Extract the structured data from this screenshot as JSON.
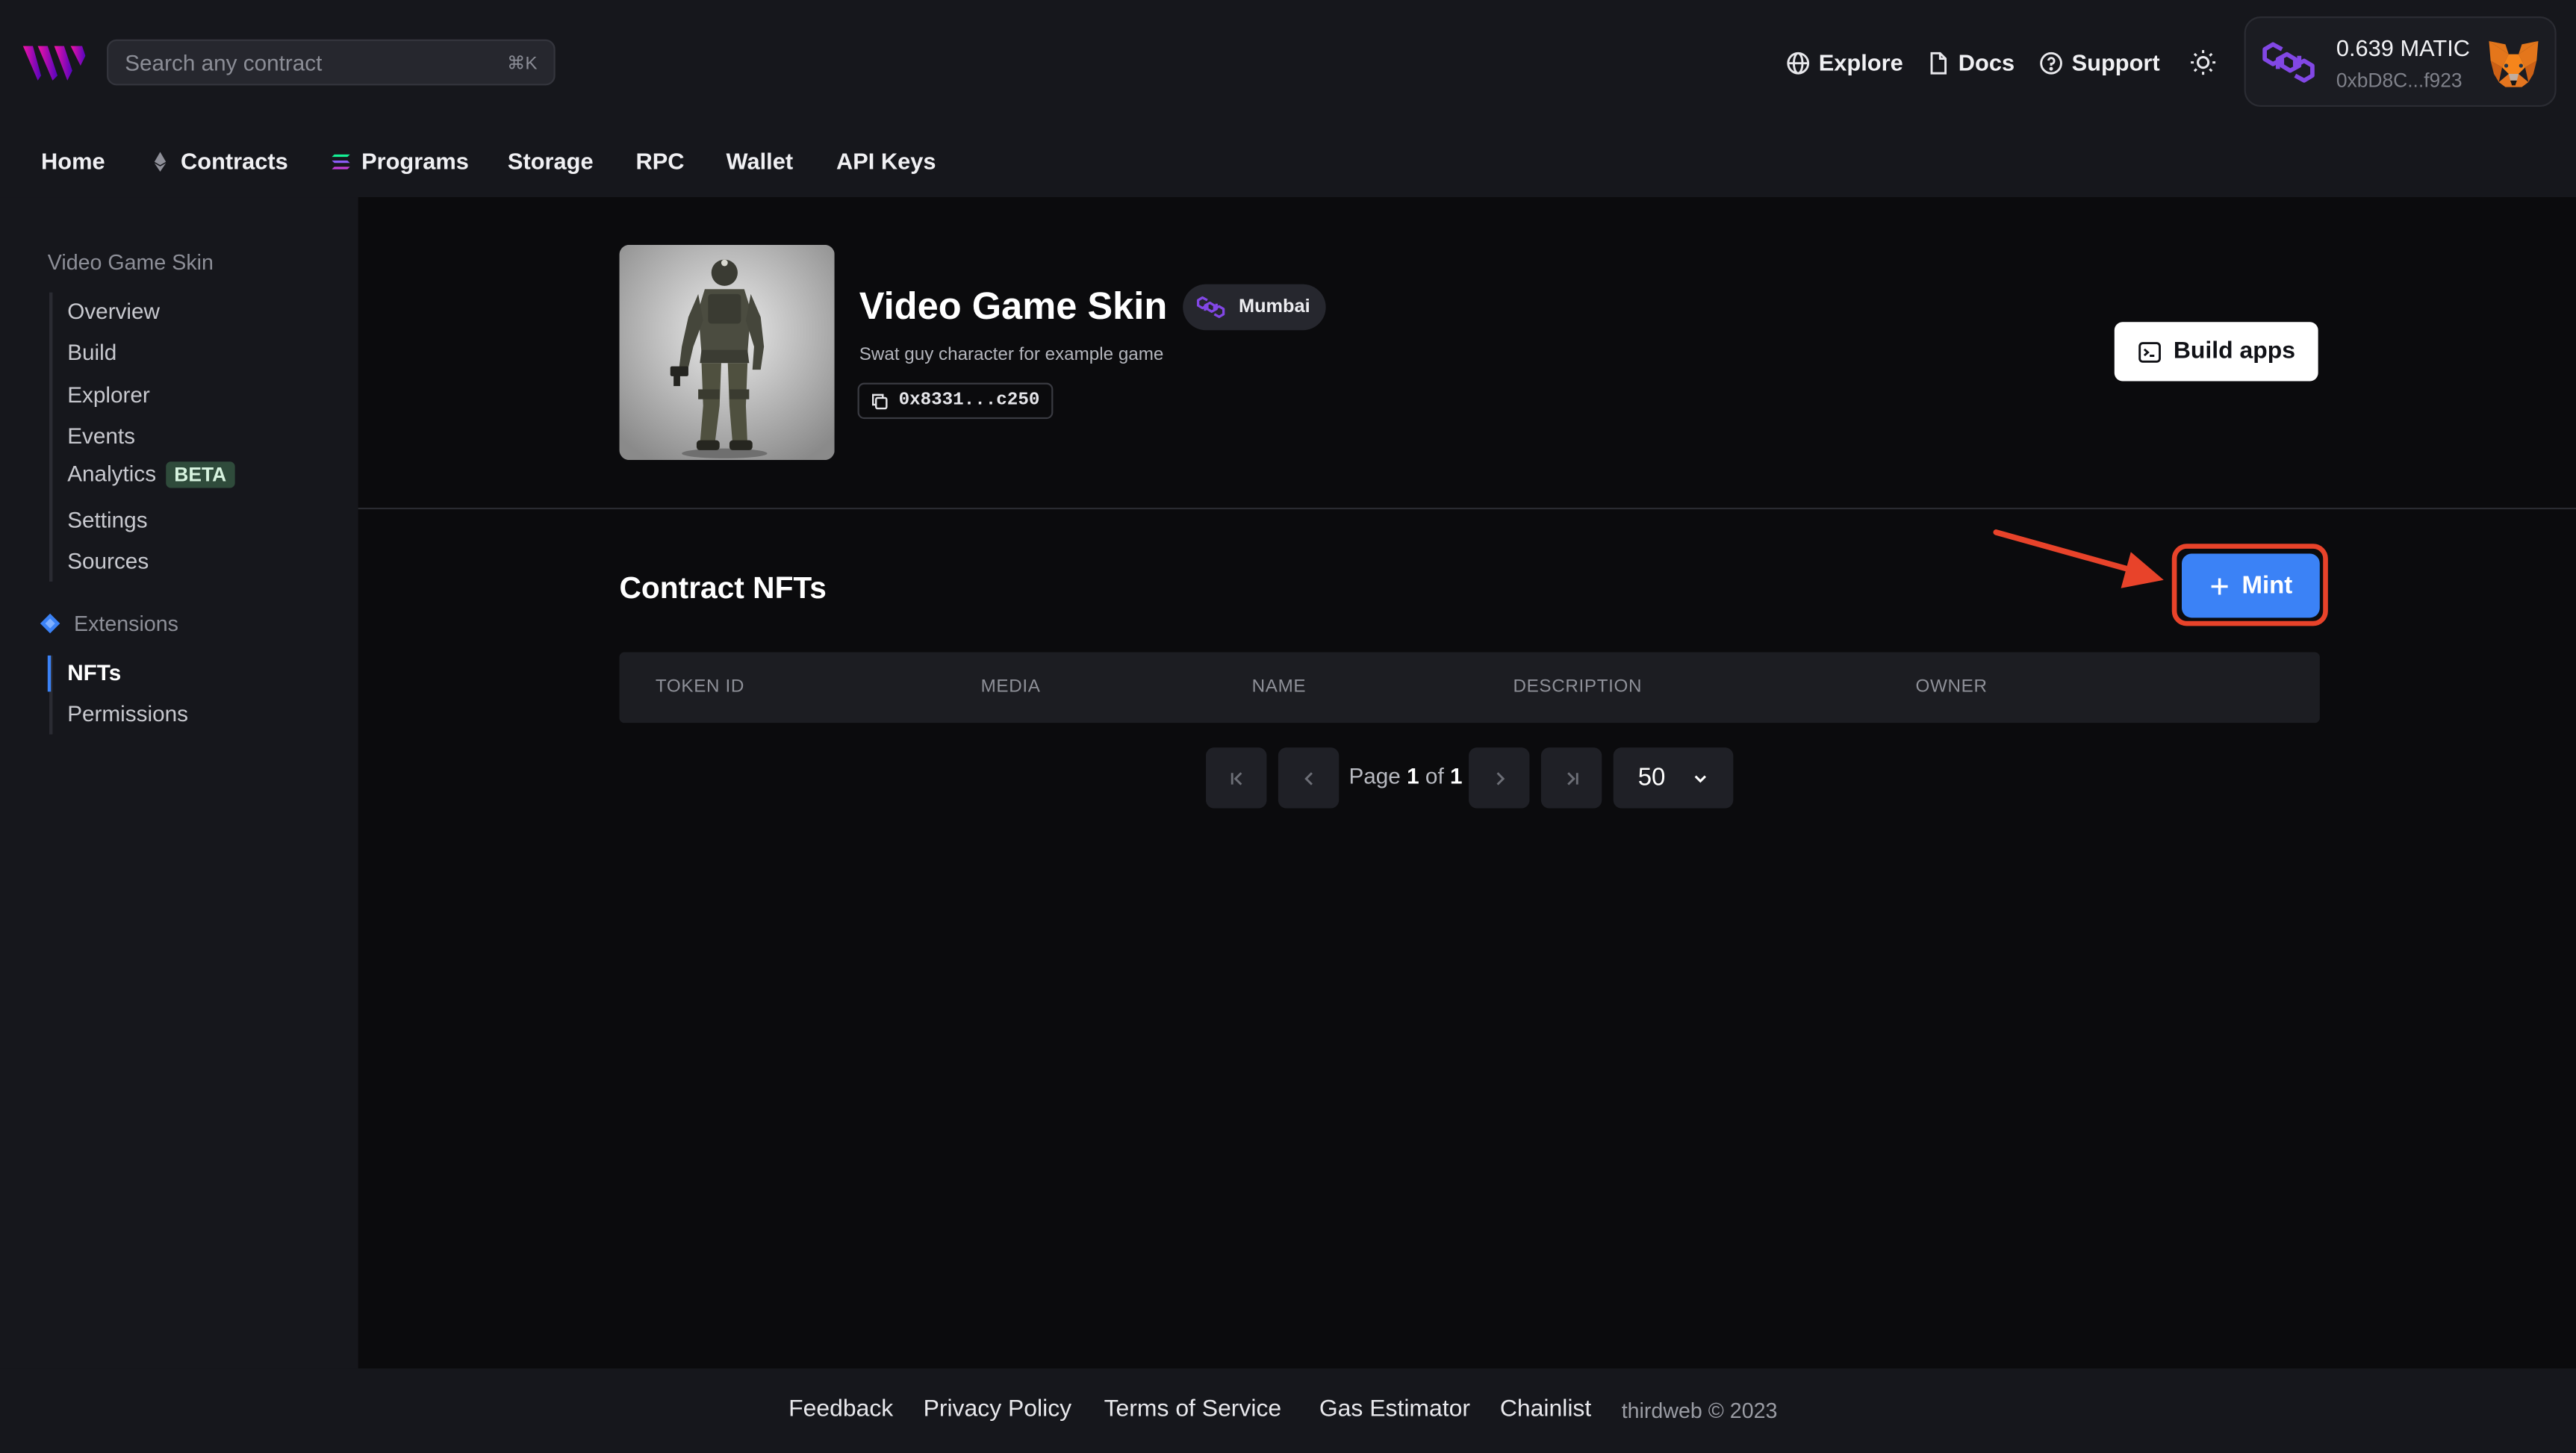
{
  "header": {
    "search_placeholder": "Search any contract",
    "search_shortcut": "⌘K",
    "links": {
      "explore": "Explore",
      "docs": "Docs",
      "support": "Support"
    },
    "wallet": {
      "balance": "0.639 MATIC",
      "address": "0xbD8C...f923"
    }
  },
  "nav": {
    "home": "Home",
    "contracts": "Contracts",
    "programs": "Programs",
    "storage": "Storage",
    "rpc": "RPC",
    "wallet": "Wallet",
    "api_keys": "API Keys"
  },
  "sidebar": {
    "title": "Video Game Skin",
    "items": {
      "overview": "Overview",
      "build": "Build",
      "explorer": "Explorer",
      "events": "Events",
      "analytics": "Analytics",
      "analytics_badge": "BETA",
      "settings": "Settings",
      "sources": "Sources"
    },
    "extensions_label": "Extensions",
    "extensions": {
      "nfts": "NFTs",
      "permissions": "Permissions"
    }
  },
  "contract": {
    "name": "Video Game Skin",
    "network": "Mumbai",
    "description": "Swat guy character for example game",
    "address": "0x8331...c250",
    "build_apps_label": "Build apps"
  },
  "nfts": {
    "section_title": "Contract NFTs",
    "mint_label": "Mint",
    "columns": {
      "token_id": "TOKEN ID",
      "media": "MEDIA",
      "name": "NAME",
      "description": "DESCRIPTION",
      "owner": "OWNER"
    },
    "pagination": {
      "page_word": "Page",
      "current": "1",
      "of_word": "of",
      "total": "1",
      "page_size": "50"
    }
  },
  "footer": {
    "feedback": "Feedback",
    "privacy": "Privacy Policy",
    "terms": "Terms of Service",
    "gas": "Gas Estimator",
    "chainlist": "Chainlist",
    "copyright": "thirdweb © 2023"
  },
  "colors": {
    "accent": "#3b82f6",
    "highlight": "#e8432a",
    "polygon": "#8247e5"
  }
}
